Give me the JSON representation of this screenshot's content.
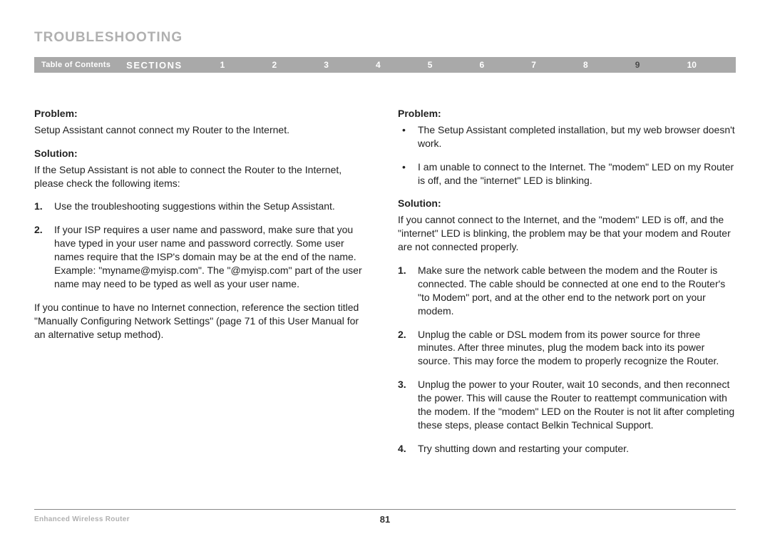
{
  "header": {
    "title": "TROUBLESHOOTING",
    "toc": "Table of Contents",
    "sections_label": "SECTIONS",
    "sections": [
      "1",
      "2",
      "3",
      "4",
      "5",
      "6",
      "7",
      "8",
      "9",
      "10"
    ],
    "current_section": "9"
  },
  "left": {
    "problem_label": "Problem:",
    "problem_text": "Setup Assistant cannot connect my Router to the Internet.",
    "solution_label": "Solution:",
    "solution_intro": "If the Setup Assistant is not able to connect the Router to the Internet, please check the following items:",
    "steps": [
      "Use the troubleshooting suggestions within the Setup Assistant.",
      "If your ISP requires a user name and password, make sure that you have typed in your user name and password correctly. Some user names require that the ISP's domain may be at the end of the name. Example: \"myname@myisp.com\". The \"@myisp.com\" part of the user name may need to be typed as well as your user name."
    ],
    "closing": "If you continue to have no Internet connection, reference the section titled \"Manually Configuring Network Settings\" (page 71 of this User Manual for an alternative setup method)."
  },
  "right": {
    "problem_label": "Problem:",
    "bullets": [
      "The Setup Assistant completed installation, but my web browser doesn't work.",
      "I am unable to connect to the Internet. The \"modem\" LED on my Router is off, and the \"internet\" LED is blinking."
    ],
    "solution_label": "Solution:",
    "solution_intro": "If you cannot connect to the Internet, and the \"modem\" LED is off, and the \"internet\" LED is blinking, the problem may be that your modem and Router are not connected properly.",
    "steps": [
      "Make sure the network cable between the modem and the Router is connected. The cable should be connected at one end to the Router's \"to Modem\" port, and at the other end to the network port on your modem.",
      "Unplug the cable or DSL modem from its power source for three minutes. After three minutes, plug the modem back into its power source. This may force the modem to properly recognize the Router.",
      "Unplug the power to your Router, wait 10 seconds, and then reconnect the power. This will cause the Router to reattempt communication with the modem. If the \"modem\" LED on the Router is not lit after completing these steps, please contact Belkin Technical Support.",
      "Try shutting down and restarting your computer."
    ]
  },
  "footer": {
    "product": "Enhanced Wireless Router",
    "page": "81"
  }
}
